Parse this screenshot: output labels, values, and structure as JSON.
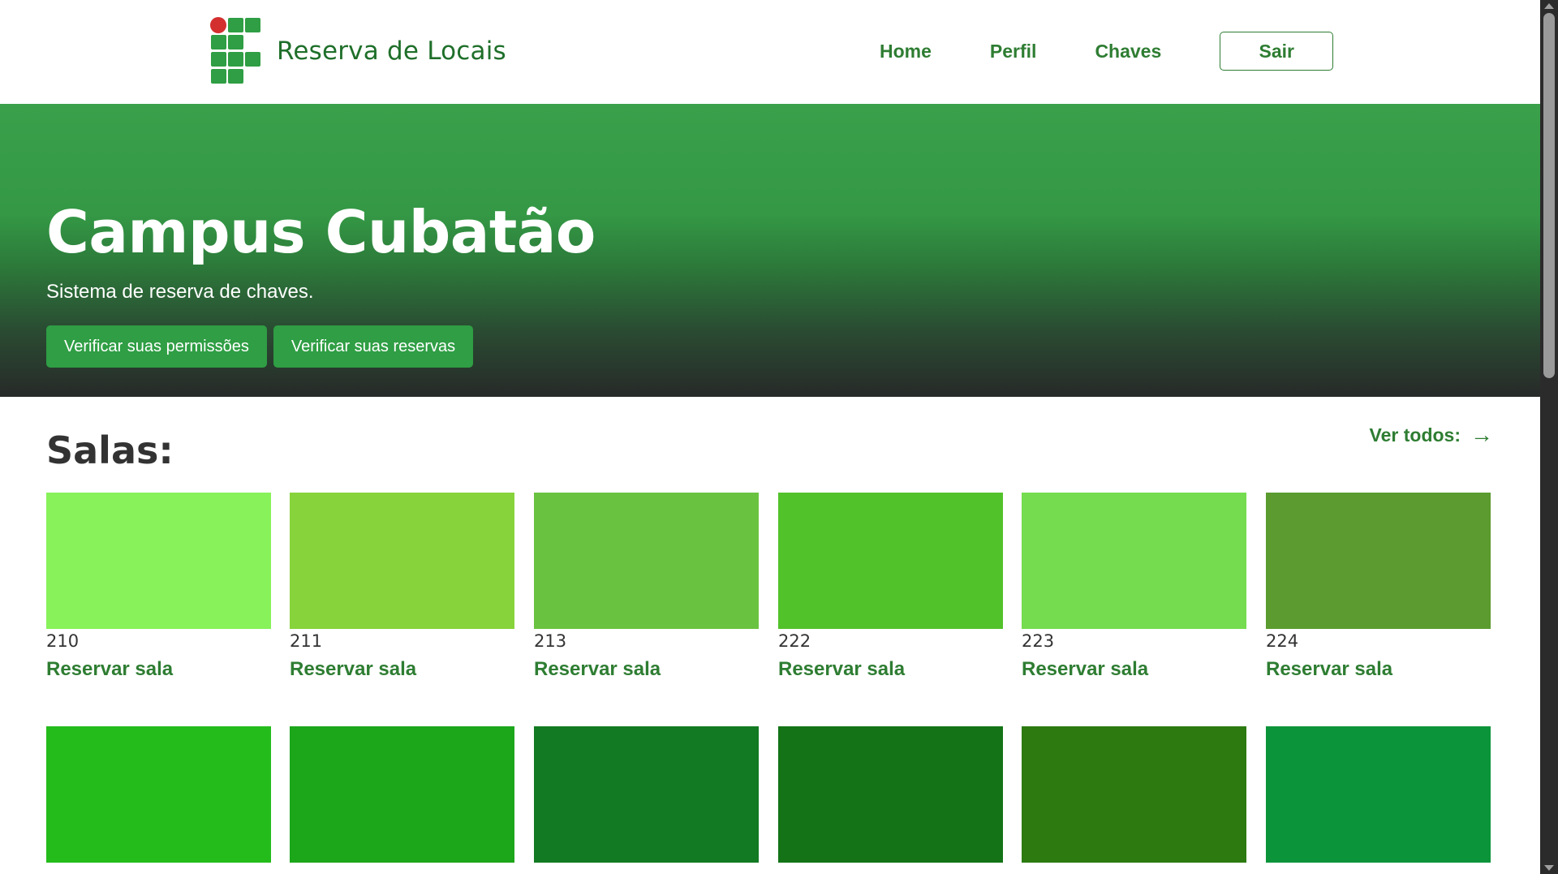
{
  "brand": {
    "title": "Reserva de Locais"
  },
  "nav": {
    "home": "Home",
    "perfil": "Perfil",
    "chaves": "Chaves",
    "sair": "Sair"
  },
  "hero": {
    "title": "Campus Cubatão",
    "subtitle": "Sistema de reserva de chaves.",
    "btn_permissions": "Verificar suas permissões",
    "btn_reservations": "Verificar suas reservas"
  },
  "rooms_section": {
    "title": "Salas:",
    "see_all": "Ver todos:",
    "see_all_icon": "arrow-right-icon",
    "reserve_label": "Reservar sala",
    "rooms": [
      {
        "number": "210",
        "color": "#87f25a"
      },
      {
        "number": "211",
        "color": "#87d33b"
      },
      {
        "number": "213",
        "color": "#6ac340"
      },
      {
        "number": "222",
        "color": "#52c22b"
      },
      {
        "number": "223",
        "color": "#74dc4e"
      },
      {
        "number": "224",
        "color": "#5b9b2f"
      },
      {
        "number": "",
        "color": "#24bc1b"
      },
      {
        "number": "",
        "color": "#1ca61a"
      },
      {
        "number": "",
        "color": "#127a22"
      },
      {
        "number": "",
        "color": "#137316"
      },
      {
        "number": "",
        "color": "#2c7a10"
      },
      {
        "number": "",
        "color": "#0c943a"
      }
    ]
  },
  "colors": {
    "brand_green": "#2e7d32",
    "button_green": "#2f9e44",
    "logo_red": "#d32f2f"
  }
}
